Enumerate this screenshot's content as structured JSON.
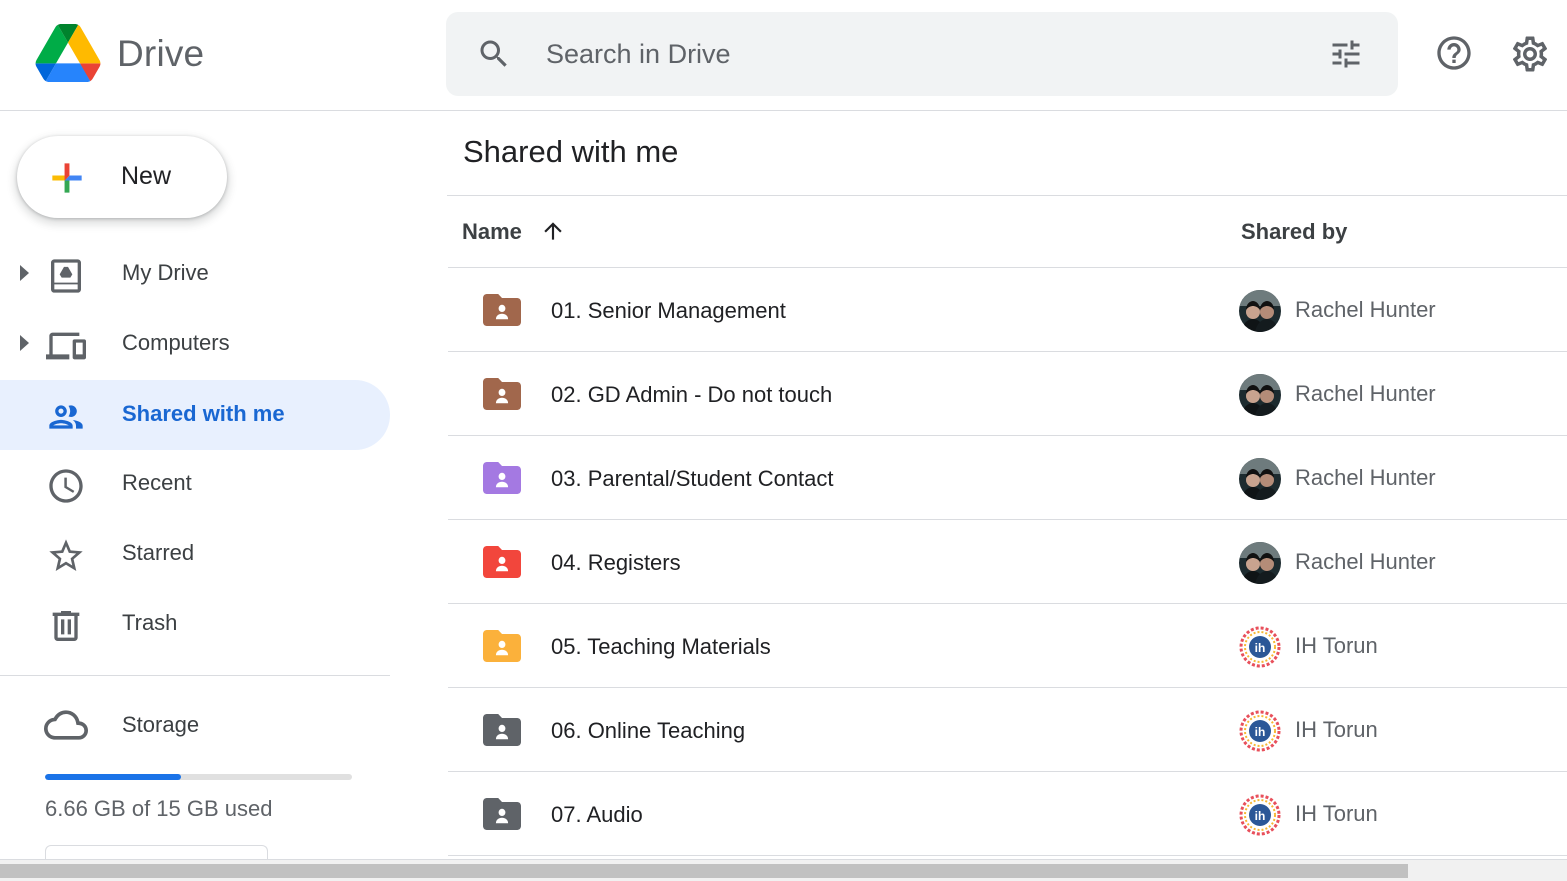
{
  "app": {
    "title": "Drive"
  },
  "search": {
    "placeholder": "Search in Drive"
  },
  "header": {
    "icons": [
      "search-icon",
      "tune-icon",
      "help-icon",
      "gear-icon"
    ]
  },
  "new_button": {
    "label": "New"
  },
  "sidebar": {
    "items": [
      {
        "label": "My Drive",
        "icon": "my-drive-icon",
        "expandable": true,
        "active": false
      },
      {
        "label": "Computers",
        "icon": "computers-icon",
        "expandable": true,
        "active": false
      },
      {
        "label": "Shared with me",
        "icon": "people-icon",
        "expandable": false,
        "active": true
      },
      {
        "label": "Recent",
        "icon": "clock-icon",
        "expandable": false,
        "active": false
      },
      {
        "label": "Starred",
        "icon": "star-icon",
        "expandable": false,
        "active": false
      },
      {
        "label": "Trash",
        "icon": "trash-icon",
        "expandable": false,
        "active": false
      }
    ],
    "storage": {
      "label": "Storage",
      "used_text": "6.66 GB of 15 GB used",
      "fraction_used": 0.444
    }
  },
  "main": {
    "title": "Shared with me",
    "columns": {
      "name": "Name",
      "shared_by": "Shared by"
    },
    "sort": {
      "column": "Name",
      "direction": "ascending"
    },
    "rows": [
      {
        "name": "01. Senior Management",
        "shared_by": "Rachel Hunter",
        "folder_color": "#a1674c",
        "avatar": "photo"
      },
      {
        "name": "02. GD Admin - Do not touch",
        "shared_by": "Rachel Hunter",
        "folder_color": "#a1674c",
        "avatar": "photo"
      },
      {
        "name": "03. Parental/Student Contact",
        "shared_by": "Rachel Hunter",
        "folder_color": "#a479e2",
        "avatar": "photo"
      },
      {
        "name": "04. Registers",
        "shared_by": "Rachel Hunter",
        "folder_color": "#f2463c",
        "avatar": "photo"
      },
      {
        "name": "05. Teaching Materials",
        "shared_by": "IH Torun",
        "folder_color": "#fbb13b",
        "avatar": "ih-logo"
      },
      {
        "name": "06. Online Teaching",
        "shared_by": "IH Torun",
        "folder_color": "#5f6368",
        "avatar": "ih-logo"
      },
      {
        "name": "07. Audio",
        "shared_by": "IH Torun",
        "folder_color": "#5f6368",
        "avatar": "ih-logo"
      }
    ]
  },
  "colors": {
    "accent": "#1a73e8",
    "active_bg": "#e8f0fe",
    "active_text": "#1967d2"
  }
}
